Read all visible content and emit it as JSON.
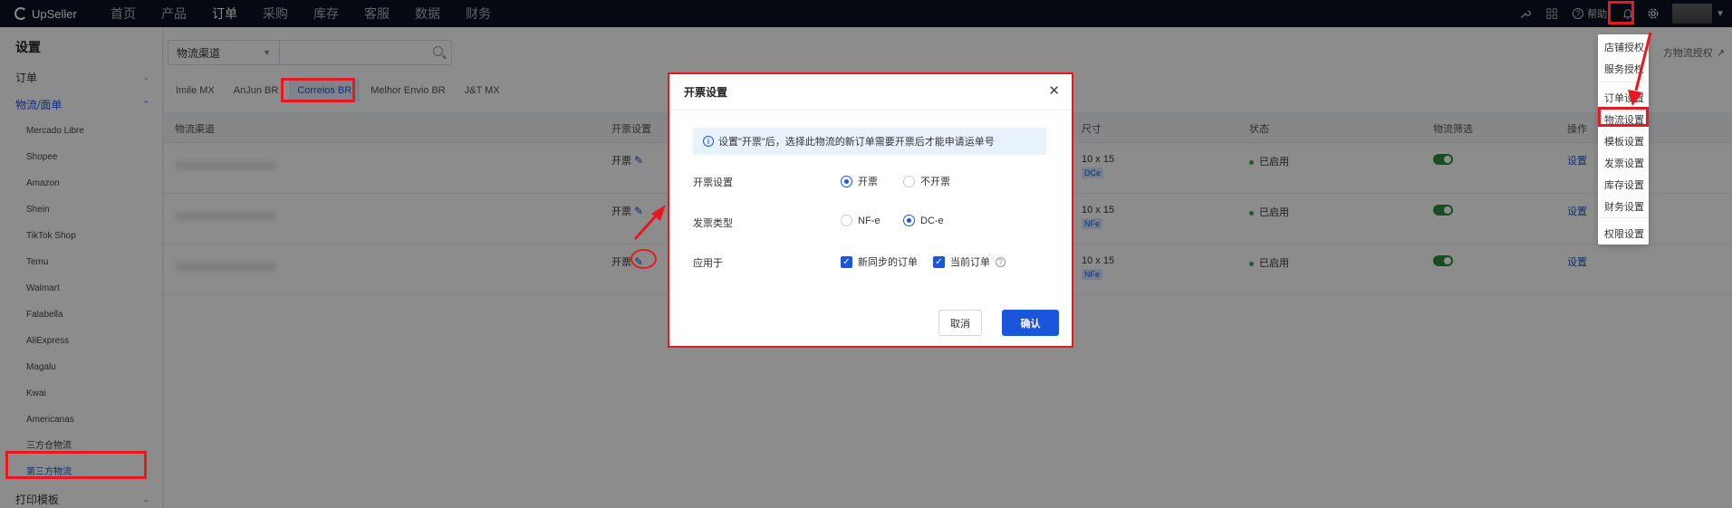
{
  "app": {
    "logo_text": "UpSeller",
    "nav": [
      "首页",
      "产品",
      "订单",
      "采购",
      "库存",
      "客服",
      "数据",
      "财务"
    ],
    "active_nav": "订单",
    "help_label": "帮助"
  },
  "sidebar": {
    "title": "设置",
    "groups": {
      "order": "订单",
      "logistics": "物流/面单",
      "print": "打印模板"
    },
    "items": [
      "Mercado Libre",
      "Shopee",
      "Amazon",
      "Shein",
      "TikTok Shop",
      "Temu",
      "Walmart",
      "Falabella",
      "AliExpress",
      "Magalu",
      "Kwai",
      "Americanas",
      "三方仓物流",
      "第三方物流"
    ],
    "active_item": "第三方物流"
  },
  "filters": {
    "select_value": "物流渠道",
    "search_value": "",
    "third_party_link": "方物流授权"
  },
  "tabs": [
    "Imile MX",
    "AnJun BR",
    "Correios BR",
    "Melhor Envio BR",
    "J&T MX"
  ],
  "active_tab": "Correios BR",
  "table": {
    "headers": {
      "channel": "物流渠道",
      "invoice": "开票设置",
      "size": "尺寸",
      "status": "状态",
      "filter": "物流筛选",
      "action": "操作"
    },
    "rows": [
      {
        "invoice": "开票",
        "size": "10 x 15",
        "badge": "DCe",
        "status": "已启用",
        "action": "设置"
      },
      {
        "invoice": "开票",
        "size": "10 x 15",
        "badge": "NFe",
        "status": "已启用",
        "action": "设置"
      },
      {
        "invoice": "开票",
        "size": "10 x 15",
        "badge": "NFe",
        "status": "已启用",
        "action": "设置"
      }
    ]
  },
  "dropdown": {
    "items": [
      "店铺授权",
      "服务授权",
      "订单设置",
      "物流设置",
      "模板设置",
      "发票设置",
      "库存设置",
      "财务设置",
      "权限设置"
    ]
  },
  "modal": {
    "title": "开票设置",
    "notice": "设置\"开票\"后，选择此物流的新订单需要开票后才能申请运单号",
    "invoice_label": "开票设置",
    "invoice_on": "开票",
    "invoice_off": "不开票",
    "type_label": "发票类型",
    "type_nfe": "NF-e",
    "type_dce": "DC-e",
    "apply_label": "应用于",
    "apply_new": "新同步的订单",
    "apply_current": "当前订单",
    "cancel": "取消",
    "confirm": "确认"
  }
}
